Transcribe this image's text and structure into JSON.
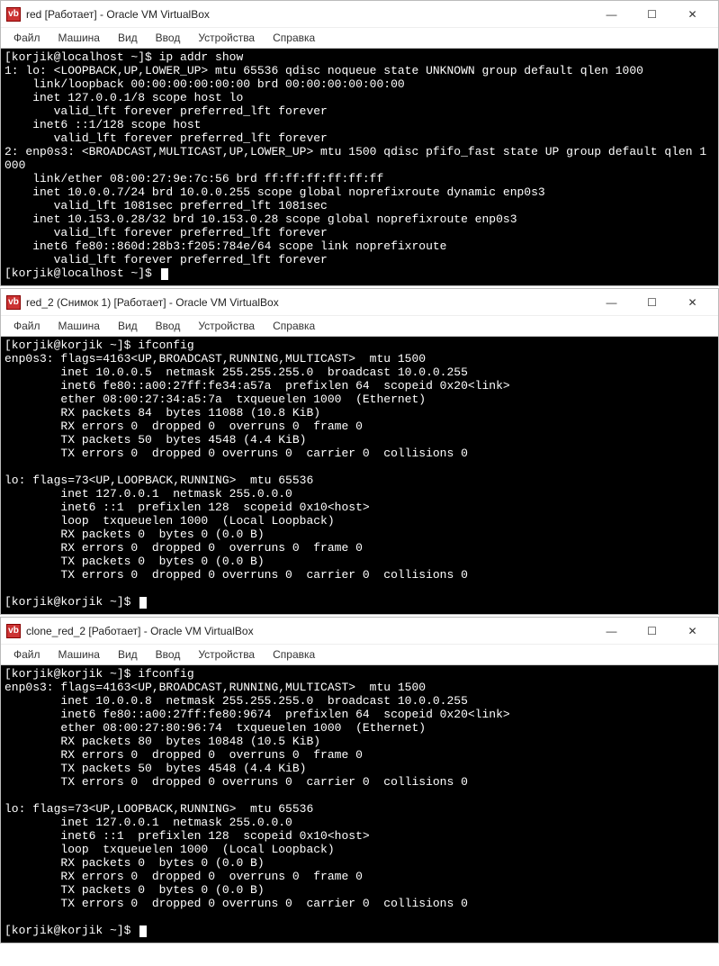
{
  "windows": [
    {
      "title": "red [Работает] - Oracle VM VirtualBox",
      "menu": [
        "Файл",
        "Машина",
        "Вид",
        "Ввод",
        "Устройства",
        "Справка"
      ],
      "terminal": "[korjik@localhost ~]$ ip addr show\n1: lo: <LOOPBACK,UP,LOWER_UP> mtu 65536 qdisc noqueue state UNKNOWN group default qlen 1000\n    link/loopback 00:00:00:00:00:00 brd 00:00:00:00:00:00\n    inet 127.0.0.1/8 scope host lo\n       valid_lft forever preferred_lft forever\n    inet6 ::1/128 scope host\n       valid_lft forever preferred_lft forever\n2: enp0s3: <BROADCAST,MULTICAST,UP,LOWER_UP> mtu 1500 qdisc pfifo_fast state UP group default qlen 1\n000\n    link/ether 08:00:27:9e:7c:56 brd ff:ff:ff:ff:ff:ff\n    inet 10.0.0.7/24 brd 10.0.0.255 scope global noprefixroute dynamic enp0s3\n       valid_lft 1081sec preferred_lft 1081sec\n    inet 10.153.0.28/32 brd 10.153.0.28 scope global noprefixroute enp0s3\n       valid_lft forever preferred_lft forever\n    inet6 fe80::860d:28b3:f205:784e/64 scope link noprefixroute\n       valid_lft forever preferred_lft forever\n[korjik@localhost ~]$ "
    },
    {
      "title": "red_2 (Снимок 1) [Работает] - Oracle VM VirtualBox",
      "menu": [
        "Файл",
        "Машина",
        "Вид",
        "Ввод",
        "Устройства",
        "Справка"
      ],
      "terminal": "[korjik@korjik ~]$ ifconfig\nenp0s3: flags=4163<UP,BROADCAST,RUNNING,MULTICAST>  mtu 1500\n        inet 10.0.0.5  netmask 255.255.255.0  broadcast 10.0.0.255\n        inet6 fe80::a00:27ff:fe34:a57a  prefixlen 64  scopeid 0x20<link>\n        ether 08:00:27:34:a5:7a  txqueuelen 1000  (Ethernet)\n        RX packets 84  bytes 11088 (10.8 KiB)\n        RX errors 0  dropped 0  overruns 0  frame 0\n        TX packets 50  bytes 4548 (4.4 KiB)\n        TX errors 0  dropped 0 overruns 0  carrier 0  collisions 0\n\nlo: flags=73<UP,LOOPBACK,RUNNING>  mtu 65536\n        inet 127.0.0.1  netmask 255.0.0.0\n        inet6 ::1  prefixlen 128  scopeid 0x10<host>\n        loop  txqueuelen 1000  (Local Loopback)\n        RX packets 0  bytes 0 (0.0 B)\n        RX errors 0  dropped 0  overruns 0  frame 0\n        TX packets 0  bytes 0 (0.0 B)\n        TX errors 0  dropped 0 overruns 0  carrier 0  collisions 0\n\n[korjik@korjik ~]$ "
    },
    {
      "title": "clone_red_2 [Работает] - Oracle VM VirtualBox",
      "menu": [
        "Файл",
        "Машина",
        "Вид",
        "Ввод",
        "Устройства",
        "Справка"
      ],
      "terminal": "[korjik@korjik ~]$ ifconfig\nenp0s3: flags=4163<UP,BROADCAST,RUNNING,MULTICAST>  mtu 1500\n        inet 10.0.0.8  netmask 255.255.255.0  broadcast 10.0.0.255\n        inet6 fe80::a00:27ff:fe80:9674  prefixlen 64  scopeid 0x20<link>\n        ether 08:00:27:80:96:74  txqueuelen 1000  (Ethernet)\n        RX packets 80  bytes 10848 (10.5 KiB)\n        RX errors 0  dropped 0  overruns 0  frame 0\n        TX packets 50  bytes 4548 (4.4 KiB)\n        TX errors 0  dropped 0 overruns 0  carrier 0  collisions 0\n\nlo: flags=73<UP,LOOPBACK,RUNNING>  mtu 65536\n        inet 127.0.0.1  netmask 255.0.0.0\n        inet6 ::1  prefixlen 128  scopeid 0x10<host>\n        loop  txqueuelen 1000  (Local Loopback)\n        RX packets 0  bytes 0 (0.0 B)\n        RX errors 0  dropped 0  overruns 0  frame 0\n        TX packets 0  bytes 0 (0.0 B)\n        TX errors 0  dropped 0 overruns 0  carrier 0  collisions 0\n\n[korjik@korjik ~]$ "
    }
  ],
  "win_controls": {
    "min": "—",
    "max": "☐",
    "close": "✕"
  }
}
